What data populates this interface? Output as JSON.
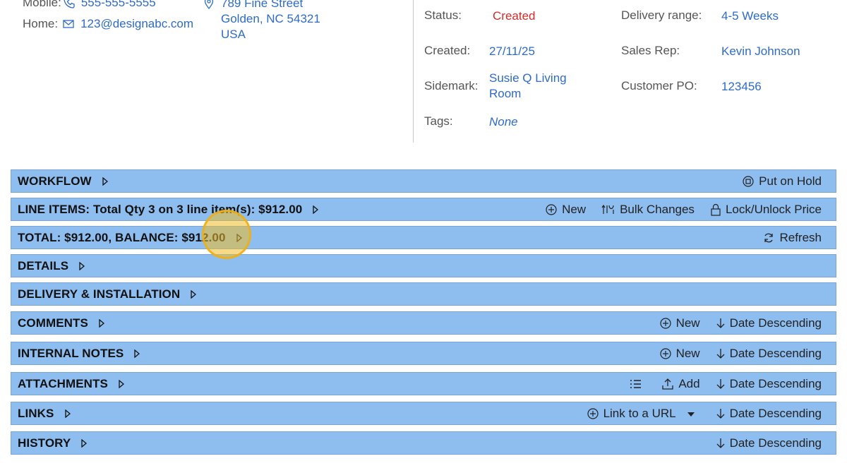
{
  "contact": {
    "mobile_label": "Mobile:",
    "mobile_value": "555-555-5555",
    "home_label": "Home:",
    "home_value": "123@designabc.com",
    "address_line1": "789 Fine Street",
    "address_line2": "Golden, NC 54321",
    "address_line3": "USA"
  },
  "info": {
    "status_label": "Status:",
    "status_value": "Created",
    "created_label": "Created:",
    "created_value": "27/11/25",
    "sidemark_label": "Sidemark:",
    "sidemark_line1": "Susie Q Living",
    "sidemark_line2": "Room",
    "tags_label": "Tags:",
    "tags_value": "None",
    "delivery_label": "Delivery range:",
    "delivery_value": "4-5 Weeks",
    "salesrep_label": "Sales Rep:",
    "salesrep_value": "Kevin Johnson",
    "po_label": "Customer PO:",
    "po_value": "123456"
  },
  "sections": {
    "workflow": {
      "title": "WORKFLOW",
      "hold": "Put on Hold"
    },
    "line_items": {
      "title": "LINE ITEMS: Total Qty 3 on 3 line item(s): $912.00",
      "new": "New",
      "bulk": "Bulk Changes",
      "lock": "Lock/Unlock Price"
    },
    "total": {
      "title": "TOTAL: $912.00, BALANCE: $912.00",
      "refresh": "Refresh"
    },
    "details": {
      "title": "DETAILS"
    },
    "delivery": {
      "title": "DELIVERY & INSTALLATION"
    },
    "comments": {
      "title": "COMMENTS",
      "new": "New",
      "sort": "Date Descending"
    },
    "internal_notes": {
      "title": "INTERNAL NOTES",
      "new": "New",
      "sort": "Date Descending"
    },
    "attachments": {
      "title": "ATTACHMENTS",
      "add": "Add",
      "sort": "Date Descending"
    },
    "links": {
      "title": "LINKS",
      "link": "Link to a URL",
      "sort": "Date Descending"
    },
    "history": {
      "title": "HISTORY",
      "sort": "Date Descending"
    }
  },
  "colors": {
    "bar_bg": "#8ebdf0",
    "link": "#2e6bc6",
    "status_red": "#d42b2b",
    "cursor_highlight": "#f0be28"
  },
  "icons": [
    "phone-icon",
    "mail-icon",
    "map-pin-icon",
    "triangle-right-icon",
    "pause-circle-icon",
    "plus-circle-icon",
    "bulk-changes-icon",
    "lock-icon",
    "refresh-icon",
    "arrow-down-icon",
    "list-icon",
    "upload-icon",
    "caret-down-icon"
  ]
}
